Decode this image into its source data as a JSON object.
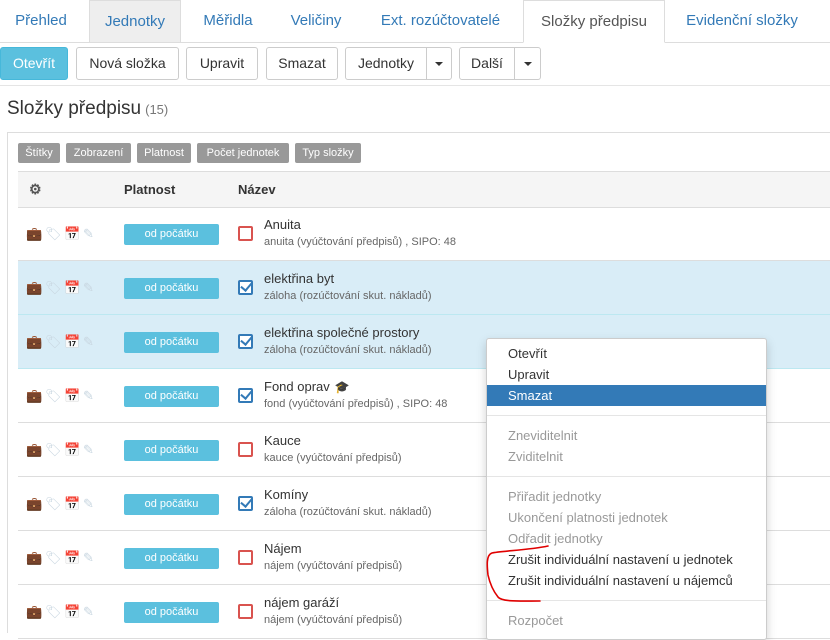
{
  "tabs": [
    "Přehled",
    "Jednotky",
    "Měřidla",
    "Veličiny",
    "Ext. rozúčtovatelé",
    "Složky předpisu",
    "Evidenční složky"
  ],
  "toolbar": {
    "open": "Otevřít",
    "new_folder": "Nová složka",
    "edit": "Upravit",
    "delete": "Smazat",
    "units": "Jednotky",
    "more": "Další"
  },
  "page": {
    "title": "Složky předpisu",
    "count": "(15)"
  },
  "filters": [
    "Štítky",
    "Zobrazení",
    "Platnost",
    "Počet jednotek",
    "Typ složky"
  ],
  "table": {
    "col_validity": "Platnost",
    "col_name": "Název",
    "rows": [
      {
        "validity": "od počátku",
        "name": "Anuita",
        "sub": "anuita (vyúčtování předpisů) , SIPO: 48",
        "checked": false,
        "selected": false
      },
      {
        "validity": "od počátku",
        "name": "elektřina byt",
        "sub": "záloha (rozúčtování skut. nákladů)",
        "checked": true,
        "selected": true
      },
      {
        "validity": "od počátku",
        "name": "elektřina společné prostory",
        "sub": "záloha (rozúčtování skut. nákladů)",
        "checked": true,
        "selected": true
      },
      {
        "validity": "od počátku",
        "name": "Fond oprav",
        "sub": "fond (vyúčtování předpisů) , SIPO: 48",
        "checked": true,
        "selected": false,
        "hat": true
      },
      {
        "validity": "od počátku",
        "name": "Kauce",
        "sub": "kauce (vyúčtování předpisů)",
        "checked": false,
        "selected": false
      },
      {
        "validity": "od počátku",
        "name": "Komíny",
        "sub": "záloha (rozúčtování skut. nákladů)",
        "checked": true,
        "selected": false
      },
      {
        "validity": "od počátku",
        "name": "Nájem",
        "sub": "nájem (vyúčtování předpisů)",
        "checked": false,
        "selected": false
      },
      {
        "validity": "od počátku",
        "name": "nájem garáží",
        "sub": "nájem (vyúčtování předpisů)",
        "checked": false,
        "selected": false
      }
    ]
  },
  "context_menu": {
    "items": [
      {
        "label": "Otevřít",
        "state": "enabled"
      },
      {
        "label": "Upravit",
        "state": "enabled"
      },
      {
        "label": "Smazat",
        "state": "active"
      },
      {
        "label": "Zneviditelnit",
        "state": "disabled"
      },
      {
        "label": "Zviditelnit",
        "state": "disabled"
      },
      {
        "label": "Přiřadit jednotky",
        "state": "disabled"
      },
      {
        "label": "Ukončení platnosti jednotek",
        "state": "disabled"
      },
      {
        "label": "Odřadit jednotky",
        "state": "disabled"
      },
      {
        "label": "Zrušit individuální nastavení u jednotek",
        "state": "enabled"
      },
      {
        "label": "Zrušit individuální nastavení u nájemců",
        "state": "enabled"
      },
      {
        "label": "Rozpočet",
        "state": "disabled"
      }
    ]
  },
  "colors": {
    "accent": "#337ab7",
    "badge": "#5bc0de",
    "selected_row": "#d9edf7",
    "annotation": "#e00000"
  }
}
